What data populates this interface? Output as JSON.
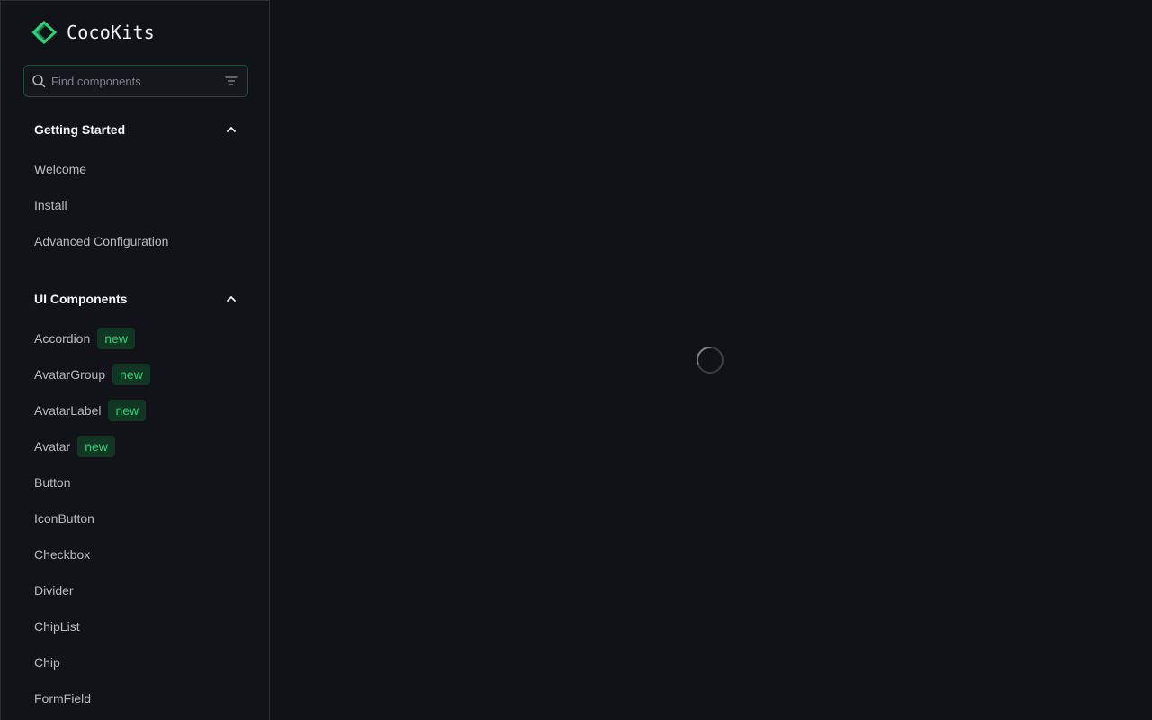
{
  "brand": {
    "name": "CocoKits",
    "accent": "#2fd07a"
  },
  "search": {
    "placeholder": "Find components",
    "value": ""
  },
  "sections": [
    {
      "title": "Getting Started",
      "expanded": true,
      "items": [
        {
          "label": "Welcome"
        },
        {
          "label": "Install"
        },
        {
          "label": "Advanced Configuration"
        }
      ]
    },
    {
      "title": "UI Components",
      "expanded": true,
      "items": [
        {
          "label": "Accordion",
          "badge": "new"
        },
        {
          "label": "AvatarGroup",
          "badge": "new"
        },
        {
          "label": "AvatarLabel",
          "badge": "new"
        },
        {
          "label": "Avatar",
          "badge": "new"
        },
        {
          "label": "Button"
        },
        {
          "label": "IconButton"
        },
        {
          "label": "Checkbox"
        },
        {
          "label": "Divider"
        },
        {
          "label": "ChipList"
        },
        {
          "label": "Chip"
        },
        {
          "label": "FormField"
        }
      ]
    }
  ],
  "icons": {
    "logo": "cocokits-logo-icon",
    "search": "search-icon",
    "filter": "filter-icon",
    "collapse": "chevron-up-icon",
    "loading": "loading-spinner-icon"
  },
  "colors": {
    "background": "#111216",
    "sidebar": "#121318",
    "badge_bg": "#113623",
    "badge_text": "#2fd07a"
  }
}
